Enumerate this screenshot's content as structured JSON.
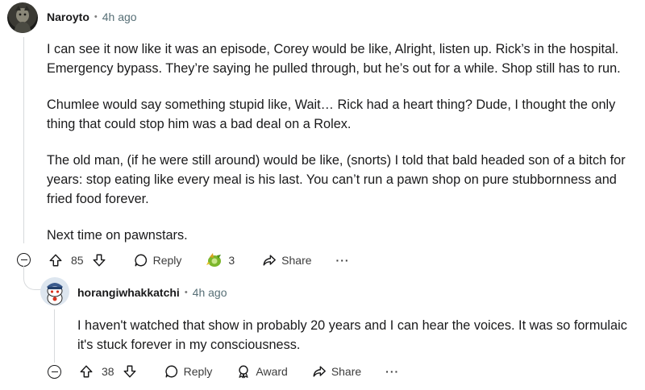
{
  "comment1": {
    "author": "Naroyto",
    "separator": "•",
    "time": "4h ago",
    "paragraphs": [
      "I can see it now like it was an episode, Corey would be like, Alright, listen up. Rick’s in the hospital. Emergency bypass. They’re saying he pulled through, but he’s out for a while. Shop still has to run.",
      "Chumlee would say something stupid like, Wait… Rick had a heart thing? Dude, I thought the only thing that could stop him was a bad deal on a Rolex.",
      "The old man, (if he were still around) would be like, (snorts) I told that bald headed son of a bitch for years: stop eating like every meal is his last. You can’t run a pawn shop on pure stubbornness and fried food forever.",
      "Next time on pawnstars."
    ],
    "votes": "85",
    "reply_label": "Reply",
    "award_count": "3",
    "share_label": "Share",
    "more_label": "···"
  },
  "comment2": {
    "author": "horangiwhakkatchi",
    "separator": "•",
    "time": "4h ago",
    "text": "I haven't watched that show in probably 20 years and I can hear the voices. It was so formulaic it's stuck forever in my consciousness.",
    "votes": "38",
    "reply_label": "Reply",
    "award_label": "Award",
    "share_label": "Share",
    "more_label": "···"
  }
}
